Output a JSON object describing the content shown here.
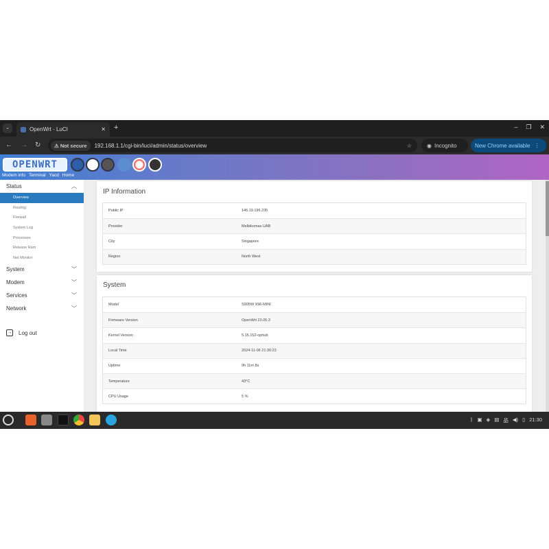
{
  "browser": {
    "tab_title": "OpenWrt - LuCI",
    "not_secure": "Not secure",
    "url": "192.168.1.1/cgi-bin/luci/admin/status/overview",
    "incognito": "Incognito",
    "new_chrome": "New Chrome available"
  },
  "header": {
    "logo": "OPENWRT",
    "links": [
      "Modem info",
      "Terminal",
      "Yacd",
      "Home"
    ]
  },
  "sidebar": {
    "status": "Status",
    "sub": [
      "Overview",
      "Routing",
      "Firewall",
      "System Log",
      "Processes",
      "Release Ram",
      "Net Monitor"
    ],
    "sections": [
      "System",
      "Modem",
      "Services",
      "Network"
    ],
    "logout": "Log out"
  },
  "ip": {
    "title": "IP Information",
    "rows": [
      [
        "Public IP",
        "146.19.196.235"
      ],
      [
        "Provider",
        "Melbikomas UAB"
      ],
      [
        "City",
        "Singapore"
      ],
      [
        "Region",
        "North West"
      ]
    ]
  },
  "system": {
    "title": "System",
    "rows": [
      [
        "Model",
        "S905W X96-MINI"
      ],
      [
        "Firmware Version",
        "OpenWrt 23.05.3"
      ],
      [
        "Kernel Version",
        "5.15.152-ophub"
      ],
      [
        "Local Time",
        "2024-11-06 21:30:23"
      ],
      [
        "Uptime",
        "0h 11m 8s"
      ],
      [
        "Temperature",
        "43°C"
      ],
      [
        "CPU Usage",
        "5 %"
      ]
    ]
  },
  "taskbar": {
    "clock": "21:30"
  }
}
